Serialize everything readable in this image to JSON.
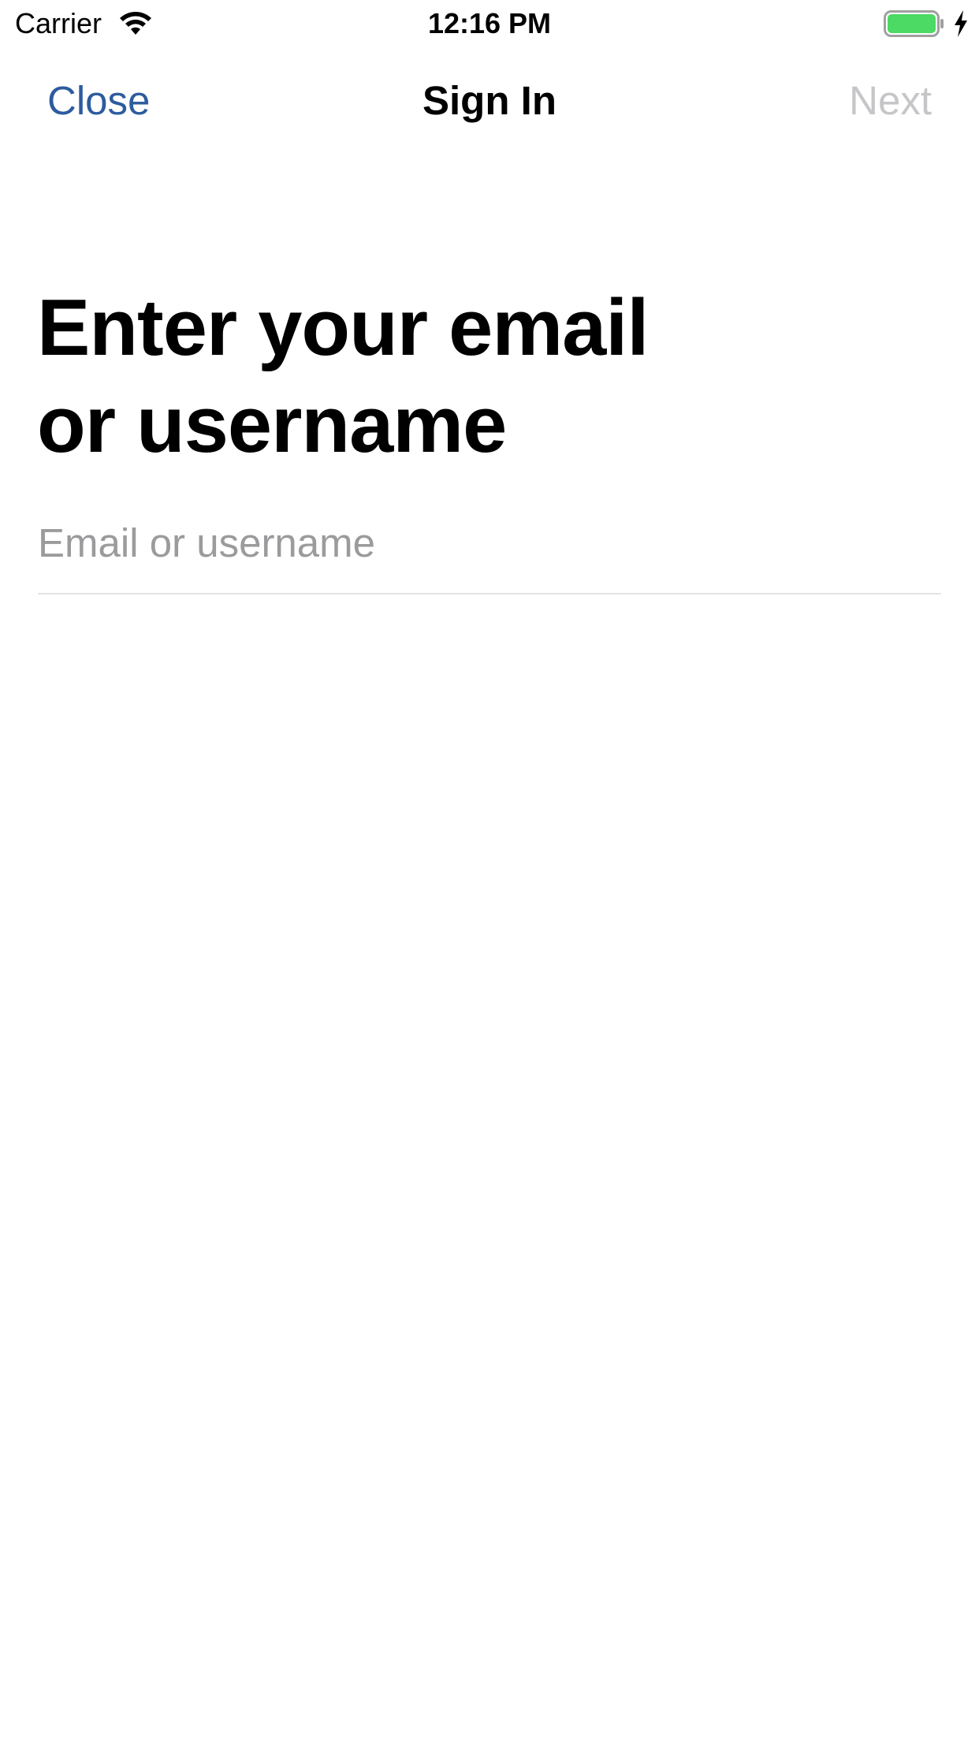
{
  "status_bar": {
    "carrier": "Carrier",
    "time": "12:16 PM",
    "icons": [
      "wifi-icon",
      "battery-icon",
      "charging-bolt-icon"
    ],
    "battery_color": "#4cd964"
  },
  "nav": {
    "close_label": "Close",
    "title": "Sign In",
    "next_label": "Next",
    "close_color": "#2d5c9e",
    "next_color_disabled": "#c6c6c9"
  },
  "main": {
    "heading_line1": "Enter your email",
    "heading_line2": "or username",
    "input": {
      "placeholder": "Email or username",
      "value": ""
    }
  }
}
